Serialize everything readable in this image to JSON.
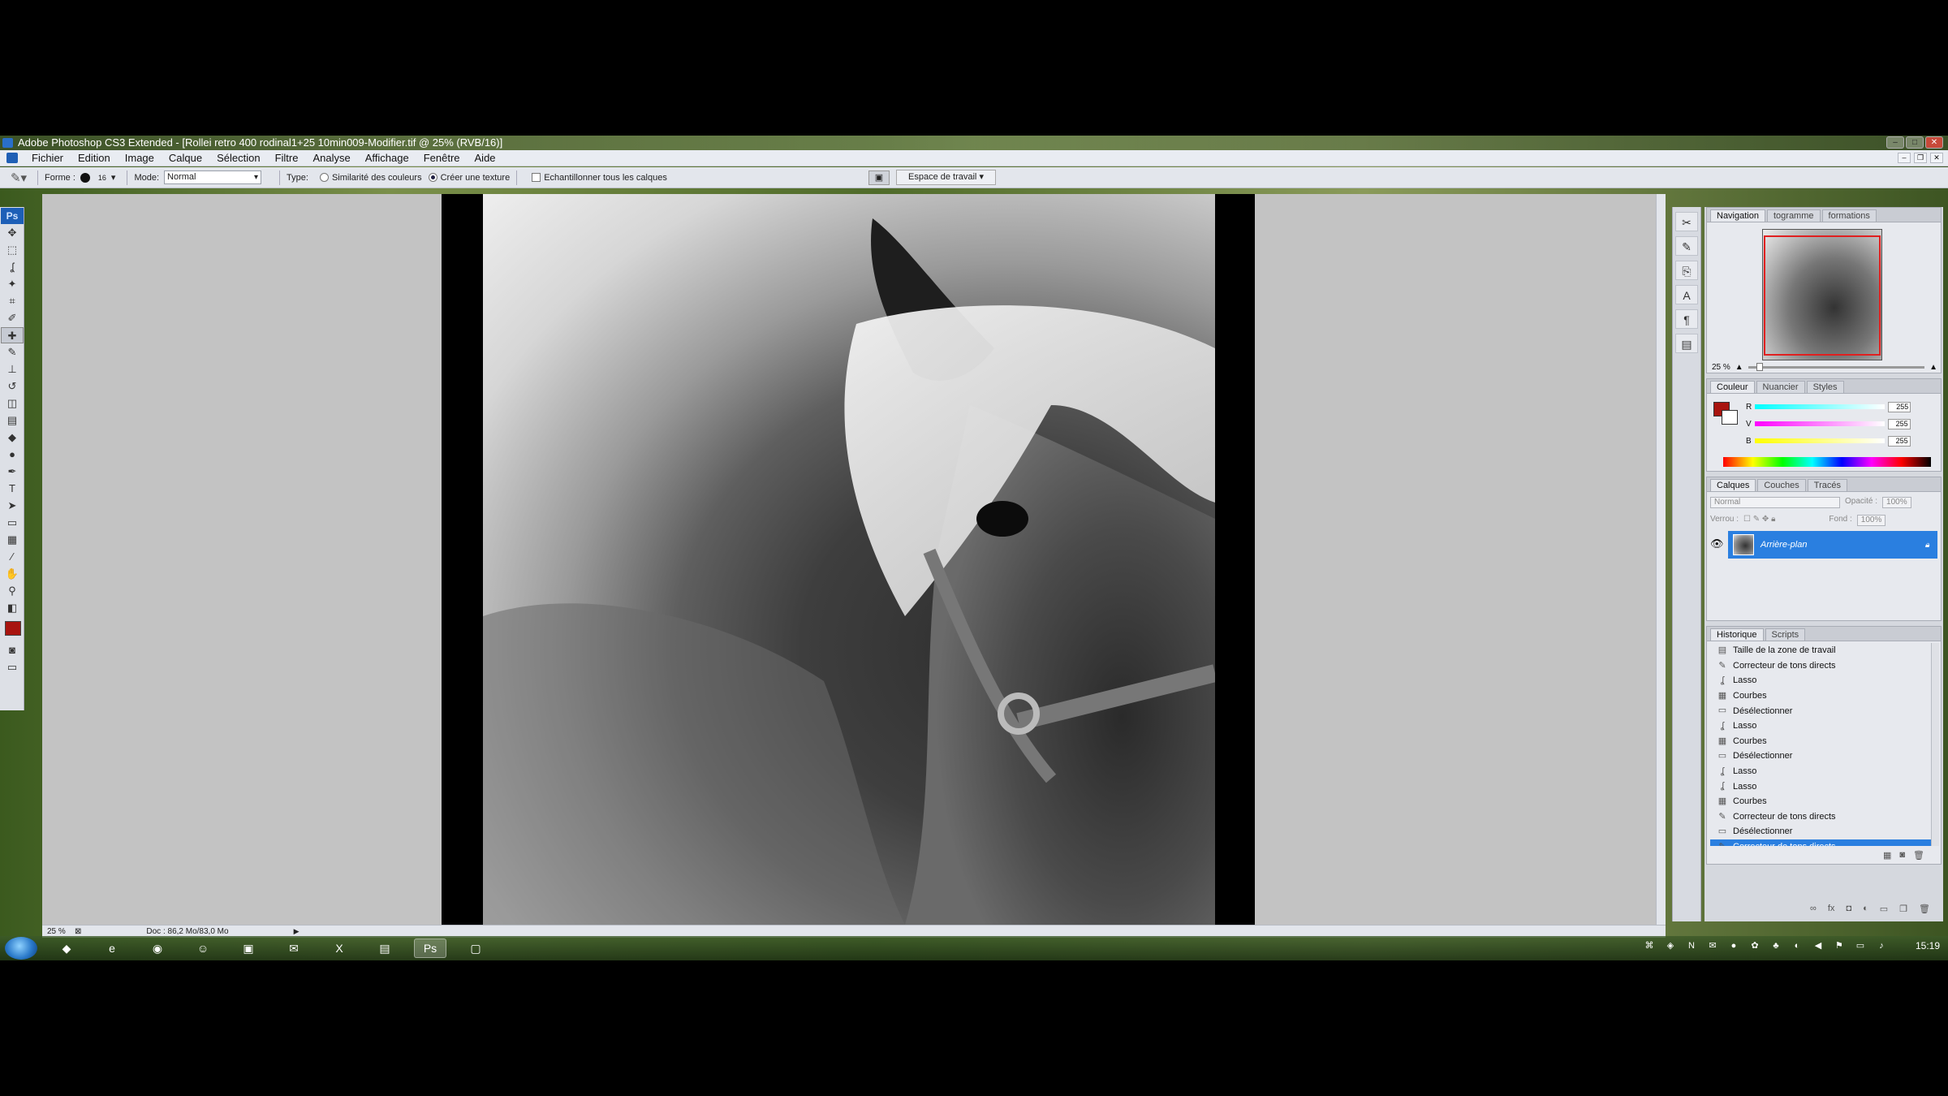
{
  "window": {
    "title": "Adobe Photoshop CS3 Extended - [Rollei retro 400 rodinal1+25 10min009-Modifier.tif @ 25% (RVB/16)]",
    "controls": [
      "–",
      "□",
      "✕"
    ]
  },
  "menu": [
    "Fichier",
    "Edition",
    "Image",
    "Calque",
    "Sélection",
    "Filtre",
    "Analyse",
    "Affichage",
    "Fenêtre",
    "Aide"
  ],
  "options": {
    "forme_label": "Forme :",
    "brush_size": "16",
    "mode_label": "Mode:",
    "mode_value": "Normal",
    "type_label": "Type:",
    "radio1": "Similarité des couleurs",
    "radio2": "Créer une texture",
    "checkbox": "Echantillonner tous les calques",
    "workspace": "Espace de travail"
  },
  "status": {
    "zoom": "25 %",
    "doc": "Doc : 86,2 Mo/83,0 Mo"
  },
  "navigation": {
    "tabs": [
      "Navigation",
      "togramme",
      "formations"
    ],
    "zoom": "25 %"
  },
  "color": {
    "tabs": [
      "Couleur",
      "Nuancier",
      "Styles"
    ],
    "channels": [
      {
        "label": "R",
        "value": "255"
      },
      {
        "label": "V",
        "value": "255"
      },
      {
        "label": "B",
        "value": "255"
      }
    ],
    "fg_color": "#a8140f"
  },
  "layers": {
    "tabs": [
      "Calques",
      "Couches",
      "Tracés"
    ],
    "blend": "Normal",
    "opacity_label": "Opacité :",
    "opacity": "100%",
    "lock_label": "Verrou :",
    "fill_label": "Fond :",
    "fill": "100%",
    "layer_name": "Arrière-plan"
  },
  "history": {
    "tabs": [
      "Historique",
      "Scripts"
    ],
    "items": [
      "Taille de la zone de travail",
      "Correcteur de tons directs",
      "Lasso",
      "Courbes",
      "Désélectionner",
      "Lasso",
      "Courbes",
      "Désélectionner",
      "Lasso",
      "Lasso",
      "Courbes",
      "Correcteur de tons directs",
      "Désélectionner",
      "Correcteur de tons directs"
    ],
    "active_index": 13
  },
  "taskbar": {
    "clock": "15:19"
  }
}
